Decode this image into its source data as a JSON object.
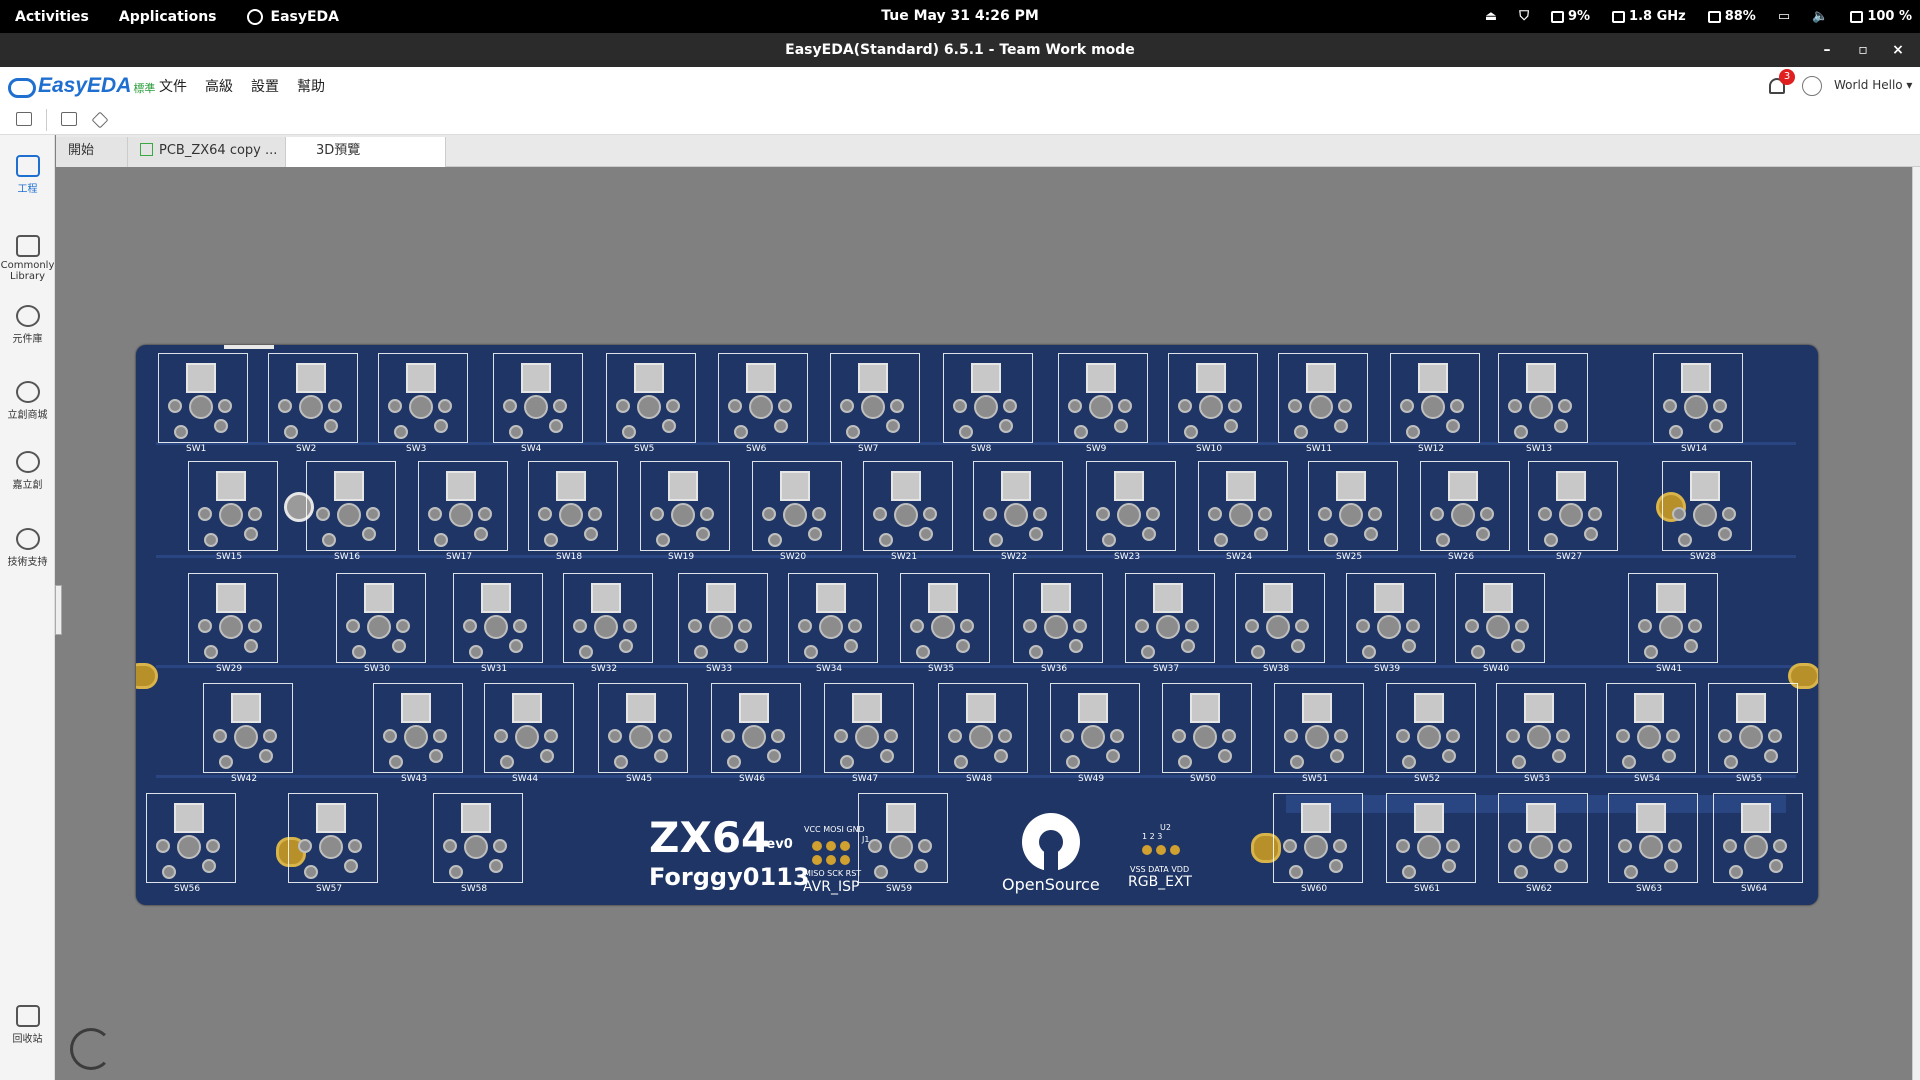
{
  "topbar": {
    "activities": "Activities",
    "applications": "Applications",
    "app_name": "EasyEDA",
    "clock": "Tue May 31   4:26 PM",
    "cpu": "9%",
    "freq": "1.8 GHz",
    "mem": "88%",
    "battery": "100 %"
  },
  "window": {
    "title": "EasyEDA(Standard) 6.5.1 - Team Work mode",
    "minimize": "–",
    "maximize": "▫",
    "close": "×"
  },
  "logo": {
    "name": "EasyEDA",
    "edition": "標準"
  },
  "menu": [
    "文件",
    "高級",
    "設置",
    "幫助"
  ],
  "notifications": {
    "count": "3"
  },
  "user": {
    "name": "World Hello ▾"
  },
  "sidebar": [
    {
      "label": "工程",
      "icon": "folder-icon",
      "active": true
    },
    {
      "label": "Commonly Library",
      "icon": "chip-icon",
      "active": false
    },
    {
      "label": "元件庫",
      "icon": "search-icon",
      "active": false
    },
    {
      "label": "立創商城",
      "icon": "lcsc-icon",
      "active": false
    },
    {
      "label": "嘉立創",
      "icon": "jlc-icon",
      "active": false
    },
    {
      "label": "技術支持",
      "icon": "help-icon",
      "active": false
    },
    {
      "label": "回收站",
      "icon": "trash-icon",
      "active": false
    }
  ],
  "tabs": [
    {
      "label": "開始",
      "active": false
    },
    {
      "label": "PCB_ZX64 copy ...",
      "active": false
    },
    {
      "label": "3D預覽",
      "active": true
    }
  ],
  "pcb": {
    "rows": [
      [
        "SW1",
        "SW2",
        "SW3",
        "SW4",
        "SW5",
        "SW6",
        "SW7",
        "SW8",
        "SW9",
        "SW10",
        "SW11",
        "SW12",
        "SW13",
        "SW14"
      ],
      [
        "SW15",
        "SW16",
        "SW17",
        "SW18",
        "SW19",
        "SW20",
        "SW21",
        "SW22",
        "SW23",
        "SW24",
        "SW25",
        "SW26",
        "SW27",
        "SW28"
      ],
      [
        "SW29",
        "SW30",
        "SW31",
        "SW32",
        "SW33",
        "SW34",
        "SW35",
        "SW36",
        "SW37",
        "SW38",
        "SW39",
        "SW40",
        "SW41"
      ],
      [
        "SW42",
        "SW43",
        "SW44",
        "SW45",
        "SW46",
        "SW47",
        "SW48",
        "SW49",
        "SW50",
        "SW51",
        "SW52",
        "SW53",
        "SW54",
        "SW55"
      ],
      [
        "SW56",
        "SW57",
        "SW58",
        "SW59",
        "SW60",
        "SW61",
        "SW62",
        "SW63",
        "SW64"
      ]
    ],
    "title": "ZX64",
    "rev": "rev0",
    "author": "Forggy0113",
    "isp_top": "VCC MOSI GND",
    "isp_bottom": "MISO SCK RST",
    "isp_ref": "J1",
    "isp_label": "AVR_ISP",
    "logo_text": "OpenSource",
    "rgb_ref": "U2",
    "rgb_pins": "1  2  3",
    "rgb_pins_names": "VSS DATA VDD",
    "rgb_label": "RGB_EXT"
  }
}
